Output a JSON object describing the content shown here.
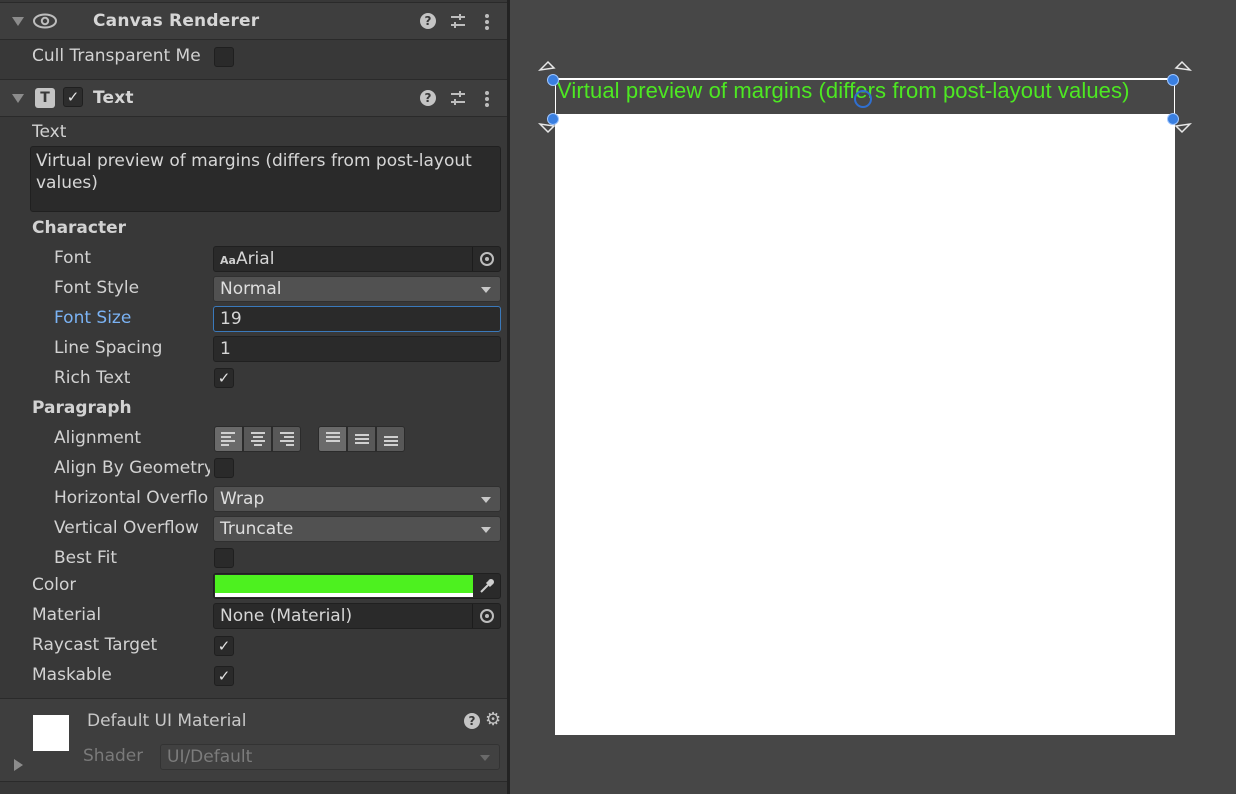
{
  "canvas_renderer": {
    "title": "Canvas Renderer",
    "cull_label": "Cull Transparent Me",
    "cull_checked": false
  },
  "text_component": {
    "title": "Text",
    "enabled": true,
    "icon_letter": "T",
    "text_label": "Text",
    "text_value": "Virtual preview of margins (differs from post-layout values)",
    "character_header": "Character",
    "font_label": "Font",
    "font_prefix": "Aa",
    "font_value": "Arial",
    "font_style_label": "Font Style",
    "font_style_value": "Normal",
    "font_size_label": "Font Size",
    "font_size_value": "19",
    "line_spacing_label": "Line Spacing",
    "line_spacing_value": "1",
    "rich_text_label": "Rich Text",
    "rich_text_checked": true,
    "paragraph_header": "Paragraph",
    "alignment_label": "Alignment",
    "align_by_geometry_label": "Align By Geometry",
    "align_by_geometry_checked": false,
    "horizontal_overflow_label": "Horizontal Overflo",
    "horizontal_overflow_value": "Wrap",
    "vertical_overflow_label": "Vertical Overflow",
    "vertical_overflow_value": "Truncate",
    "best_fit_label": "Best Fit",
    "best_fit_checked": false,
    "color_label": "Color",
    "color_value": "#4df11f",
    "material_label": "Material",
    "material_value": "None (Material)",
    "raycast_label": "Raycast Target",
    "raycast_checked": true,
    "maskable_label": "Maskable",
    "maskable_checked": true
  },
  "material_preview": {
    "name": "Default UI Material",
    "shader_label": "Shader",
    "shader_value": "UI/Default"
  },
  "scene": {
    "preview_text": "Virtual preview of margins (differs from post-layout values)",
    "text_color": "#4de822"
  },
  "icons": {
    "check": "✓",
    "help": "?",
    "gear": "⚙"
  }
}
